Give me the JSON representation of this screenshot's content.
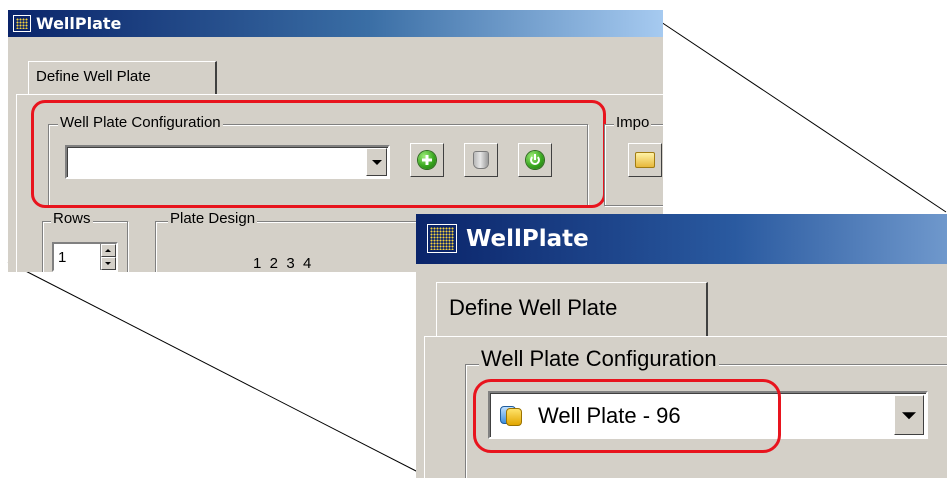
{
  "small_window": {
    "title": "WellPlate",
    "tab_label": "Define Well Plate",
    "config_group_label": "Well Plate Configuration",
    "config_combo_value": "",
    "import_group_label": "Impo",
    "rows_group_label": "Rows",
    "rows_value": "1",
    "plate_design_label": "Plate Design",
    "plate_columns": "1  2  3  4",
    "buttons": {
      "add_icon": "plus-circle-icon",
      "delete_icon": "trash-can-icon",
      "refresh_icon": "power-icon",
      "import_icon": "folder-icon"
    }
  },
  "zoom_window": {
    "title": "WellPlate",
    "tab_label": "Define Well Plate",
    "config_group_label": "Well Plate Configuration",
    "config_combo_value": "Well Plate - 96",
    "combo_icon": "database-icon"
  },
  "colors": {
    "highlight": "#e8141e",
    "titlebar_start": "#0a246a",
    "titlebar_end": "#a6caf0",
    "window_face": "#d4d0c8"
  }
}
